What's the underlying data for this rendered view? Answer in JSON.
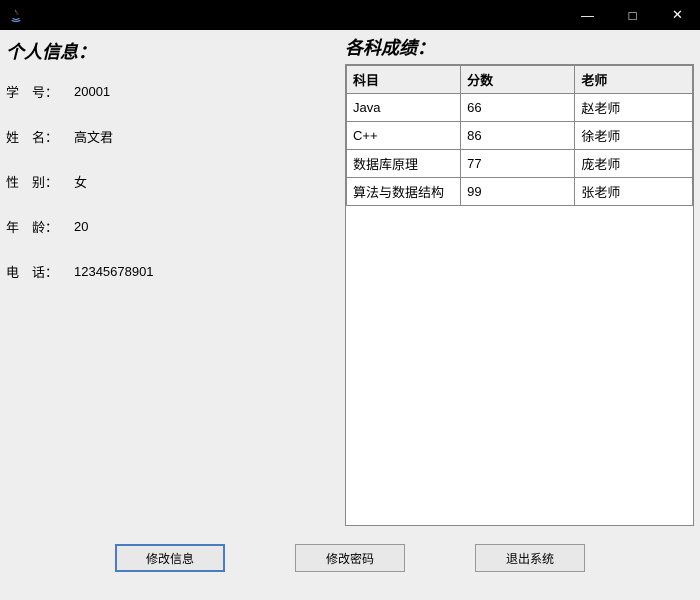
{
  "window": {
    "title": "",
    "minimize": "—",
    "maximize": "□",
    "close": "✕"
  },
  "left": {
    "title": "个人信息：",
    "labels": {
      "id": "学　号：",
      "name": "姓　名：",
      "gender": "性　别：",
      "age": "年　龄：",
      "phone": "电　话："
    },
    "values": {
      "id": "20001",
      "name": "高文君",
      "gender": "女",
      "age": "20",
      "phone": "12345678901"
    }
  },
  "right": {
    "title": "各科成绩：",
    "headers": [
      "科目",
      "分数",
      "老师"
    ],
    "rows": [
      {
        "subject": "Java",
        "score": "66",
        "teacher": "赵老师"
      },
      {
        "subject": "C++",
        "score": "86",
        "teacher": "徐老师"
      },
      {
        "subject": "数据库原理",
        "score": "77",
        "teacher": "庞老师"
      },
      {
        "subject": "算法与数据结构",
        "score": "99",
        "teacher": "张老师"
      }
    ]
  },
  "buttons": {
    "edit_info": "修改信息",
    "change_pwd": "修改密码",
    "exit": "退出系统"
  }
}
